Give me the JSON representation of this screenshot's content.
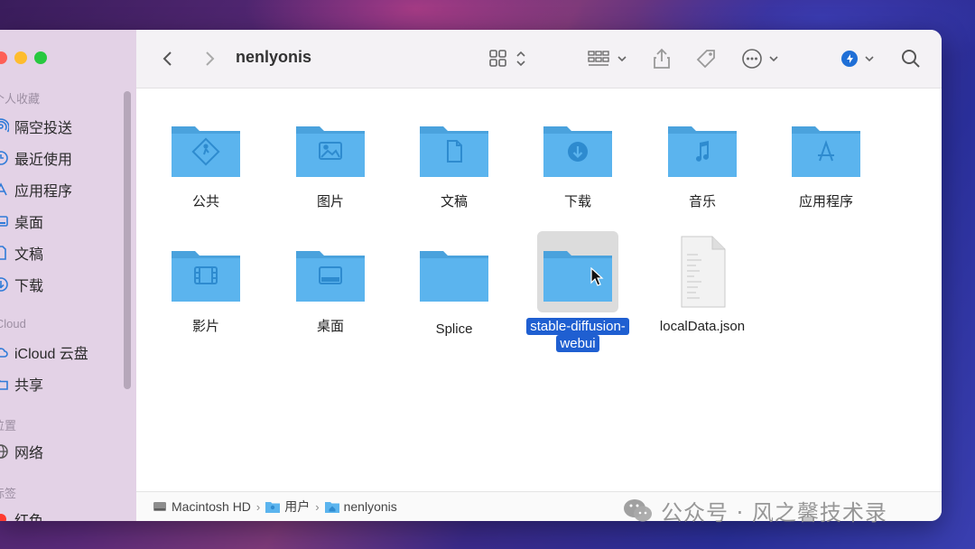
{
  "window": {
    "title": "nenlyonis"
  },
  "sidebar": {
    "sections": [
      {
        "label": "个人收藏"
      },
      {
        "label": "iCloud"
      },
      {
        "label": "位置"
      },
      {
        "label": "标签"
      }
    ],
    "favorites": [
      {
        "label": "隔空投送",
        "icon": "airdrop-icon"
      },
      {
        "label": "最近使用",
        "icon": "clock-icon"
      },
      {
        "label": "应用程序",
        "icon": "applications-icon"
      },
      {
        "label": "桌面",
        "icon": "desktop-icon"
      },
      {
        "label": "文稿",
        "icon": "document-icon"
      },
      {
        "label": "下载",
        "icon": "download-icon"
      }
    ],
    "icloud": [
      {
        "label": "iCloud 云盘",
        "icon": "cloud-icon"
      },
      {
        "label": "共享",
        "icon": "shared-folder-icon"
      }
    ],
    "locations": [
      {
        "label": "网络",
        "icon": "network-icon"
      }
    ],
    "tags": [
      {
        "label": "红色",
        "color": "#ff3b30"
      }
    ]
  },
  "files": [
    {
      "name": "公共",
      "kind": "folder",
      "glyph": "public"
    },
    {
      "name": "图片",
      "kind": "folder",
      "glyph": "pictures"
    },
    {
      "name": "文稿",
      "kind": "folder",
      "glyph": "documents"
    },
    {
      "name": "下载",
      "kind": "folder",
      "glyph": "downloads"
    },
    {
      "name": "音乐",
      "kind": "folder",
      "glyph": "music"
    },
    {
      "name": "应用程序",
      "kind": "folder",
      "glyph": "applications"
    },
    {
      "name": "影片",
      "kind": "folder",
      "glyph": "movies"
    },
    {
      "name": "桌面",
      "kind": "folder",
      "glyph": "desktop"
    },
    {
      "name": "Splice",
      "kind": "folder",
      "glyph": "none"
    },
    {
      "name": "stable-diffusion-webui",
      "kind": "folder",
      "glyph": "none",
      "selected": true
    },
    {
      "name": "localData.json",
      "kind": "file"
    }
  ],
  "pathbar": {
    "crumbs": [
      "Macintosh HD",
      "用户",
      "nenlyonis"
    ]
  },
  "watermark": {
    "text": "公众号 · 风之馨技术录"
  },
  "colors": {
    "folder": "#5bb4ee",
    "folder_dark": "#4aa2dd",
    "selection": "#1f5fd1"
  }
}
